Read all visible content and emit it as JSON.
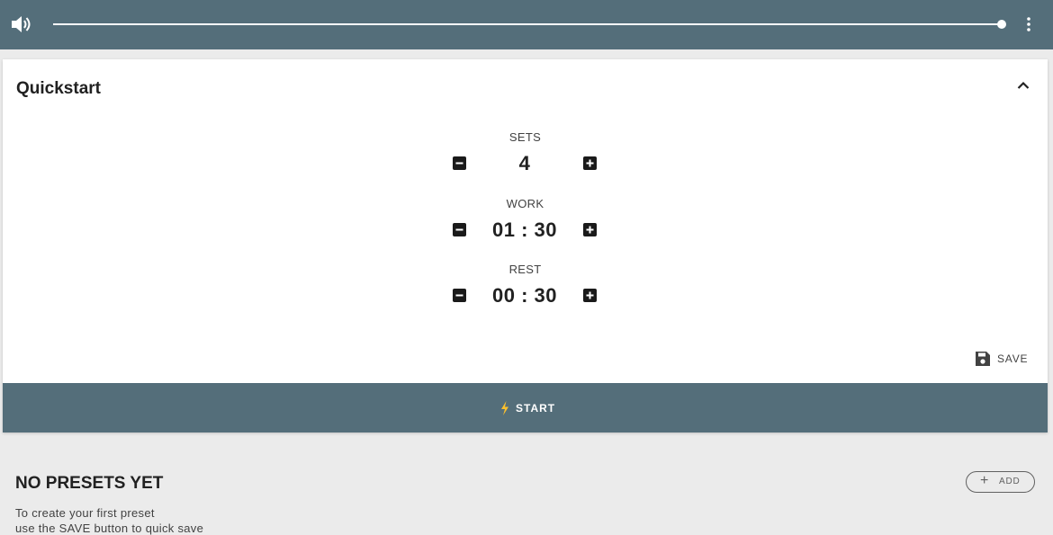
{
  "topbar": {
    "volume_level": 1.0,
    "icons": {
      "volume": "volume-up-icon",
      "menu": "more-vert-icon"
    }
  },
  "quickstart": {
    "title": "Quickstart",
    "collapse_icon": "chevron-up-icon",
    "sets": {
      "label": "SETS",
      "value": "4"
    },
    "work": {
      "label": "WORK",
      "value": "01 : 30"
    },
    "rest": {
      "label": "REST",
      "value": "00 : 30"
    },
    "save_label": "SAVE",
    "save_icon": "floppy-disk-icon"
  },
  "start": {
    "label": "START",
    "icon": "bolt-icon",
    "icon_color": "#fbc02d"
  },
  "presets": {
    "title": "NO PRESETS YET",
    "line1": "To create your first preset",
    "line2": "use the SAVE button to quick save",
    "add_label": "ADD",
    "add_symbol": "+"
  },
  "colors": {
    "bar": "#546e7a",
    "background": "#ebebeb",
    "card": "#ffffff"
  }
}
